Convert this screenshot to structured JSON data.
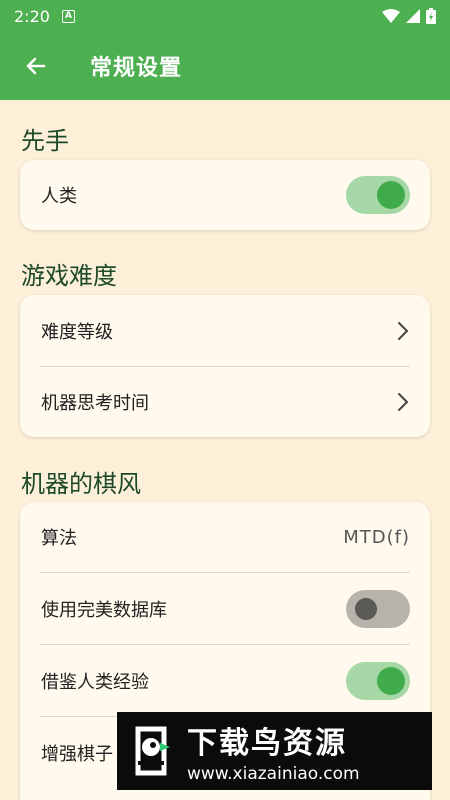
{
  "status_bar": {
    "time": "2:20",
    "notification_icon": "A"
  },
  "app_bar": {
    "title": "常规设置"
  },
  "sections": [
    {
      "header": "先手",
      "items": [
        {
          "label": "人类",
          "control": "switch",
          "on": true
        }
      ]
    },
    {
      "header": "游戏难度",
      "items": [
        {
          "label": "难度等级",
          "control": "chevron"
        },
        {
          "label": "机器思考时间",
          "control": "chevron"
        }
      ]
    },
    {
      "header": "机器的棋风",
      "items": [
        {
          "label": "算法",
          "control": "value",
          "value": "MTD(f)"
        },
        {
          "label": "使用完美数据库",
          "control": "switch",
          "on": false
        },
        {
          "label": "借鉴人类经验",
          "control": "switch",
          "on": true
        },
        {
          "label": "增强棋子",
          "control": "partial"
        }
      ]
    }
  ],
  "watermark": {
    "title": "下载鸟资源",
    "url": "www.xiazainiao.com"
  },
  "colors": {
    "primary": "#4caf50",
    "background": "#fdf0d8",
    "card": "#fff9ee",
    "switch_on_thumb": "#3fab4a",
    "switch_on_track": "#a6d7a6"
  }
}
